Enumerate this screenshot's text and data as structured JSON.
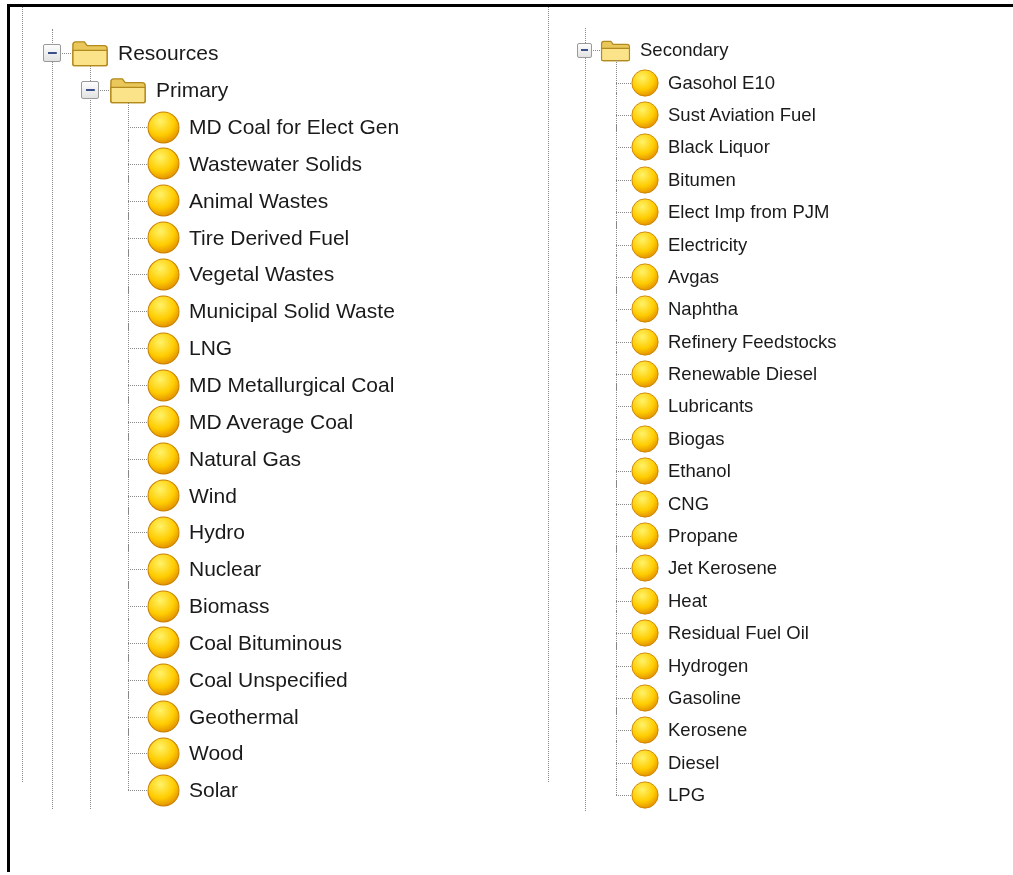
{
  "left_tree": [
    {
      "label": "Resources",
      "expanded": true,
      "children": [
        {
          "label": "Primary",
          "expanded": true,
          "children": [
            {
              "label": "MD Coal for Elect Gen"
            },
            {
              "label": "Wastewater Solids"
            },
            {
              "label": "Animal Wastes"
            },
            {
              "label": "Tire Derived Fuel"
            },
            {
              "label": "Vegetal Wastes"
            },
            {
              "label": "Municipal Solid Waste"
            },
            {
              "label": "LNG"
            },
            {
              "label": "MD Metallurgical Coal"
            },
            {
              "label": "MD Average Coal"
            },
            {
              "label": "Natural Gas"
            },
            {
              "label": "Wind"
            },
            {
              "label": "Hydro"
            },
            {
              "label": "Nuclear"
            },
            {
              "label": "Biomass"
            },
            {
              "label": "Coal Bituminous"
            },
            {
              "label": "Coal Unspecified"
            },
            {
              "label": "Geothermal"
            },
            {
              "label": "Wood"
            },
            {
              "label": "Solar"
            }
          ]
        }
      ]
    }
  ],
  "right_tree": [
    {
      "label": "Secondary",
      "expanded": true,
      "children": [
        {
          "label": "Gasohol E10"
        },
        {
          "label": "Sust Aviation Fuel"
        },
        {
          "label": "Black Liquor"
        },
        {
          "label": "Bitumen"
        },
        {
          "label": "Elect Imp from PJM"
        },
        {
          "label": "Electricity"
        },
        {
          "label": "Avgas"
        },
        {
          "label": "Naphtha"
        },
        {
          "label": "Refinery Feedstocks"
        },
        {
          "label": "Renewable Diesel"
        },
        {
          "label": "Lubricants"
        },
        {
          "label": "Biogas"
        },
        {
          "label": "Ethanol"
        },
        {
          "label": "CNG"
        },
        {
          "label": "Propane"
        },
        {
          "label": "Jet Kerosene"
        },
        {
          "label": "Heat"
        },
        {
          "label": "Residual Fuel Oil"
        },
        {
          "label": "Hydrogen"
        },
        {
          "label": "Gasoline"
        },
        {
          "label": "Kerosene"
        },
        {
          "label": "Diesel"
        },
        {
          "label": "LPG"
        }
      ]
    }
  ]
}
